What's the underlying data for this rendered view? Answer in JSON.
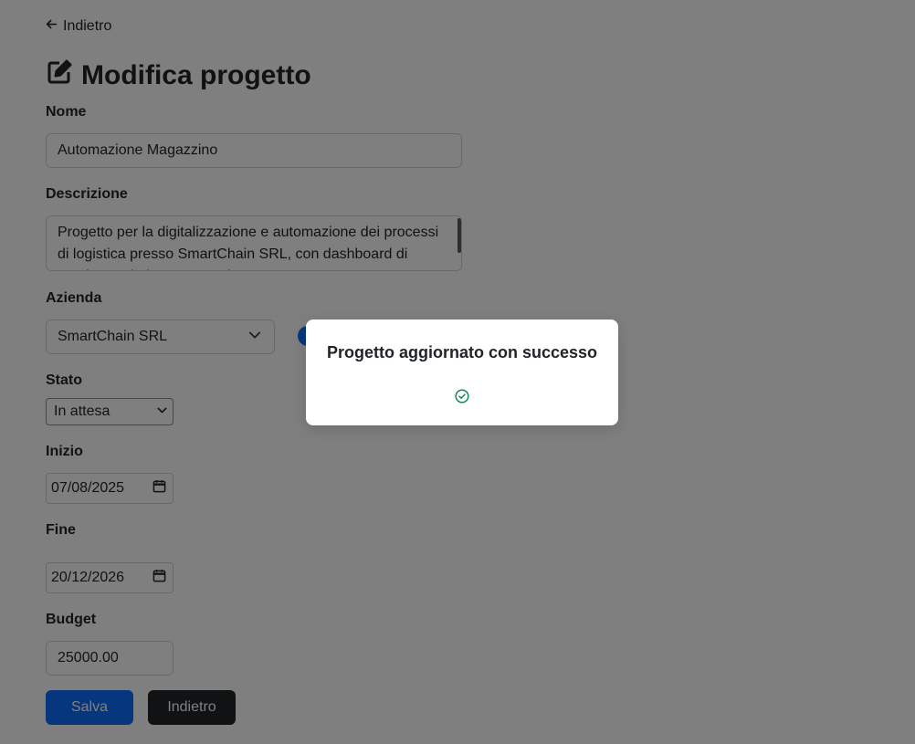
{
  "nav": {
    "back_label": "Indietro"
  },
  "page": {
    "title": "Modifica progetto"
  },
  "form": {
    "nome": {
      "label": "Nome",
      "value": "Automazione Magazzino"
    },
    "descrizione": {
      "label": "Descrizione",
      "value": "Progetto per la digitalizzazione e automazione dei processi di logistica presso SmartChain SRL, con dashboard di monitoraggio in tempo reale."
    },
    "azienda": {
      "label": "Azienda",
      "selected": "SmartChain SRL"
    },
    "stato": {
      "label": "Stato",
      "selected": "In attesa"
    },
    "inizio": {
      "label": "Inizio",
      "value": "07/08/2025"
    },
    "fine": {
      "label": "Fine",
      "value": "20/12/2026"
    },
    "budget": {
      "label": "Budget",
      "value": "25000.00"
    },
    "save_label": "Salva",
    "back_button_label": "Indietro"
  },
  "alert": {
    "message": "Progetto aggiornato con successo",
    "icon": "check-circle-icon"
  },
  "colors": {
    "primary": "#0d6efd",
    "dark": "#212529",
    "success": "#198754",
    "overlay": "rgba(0,0,0,0.5)"
  }
}
